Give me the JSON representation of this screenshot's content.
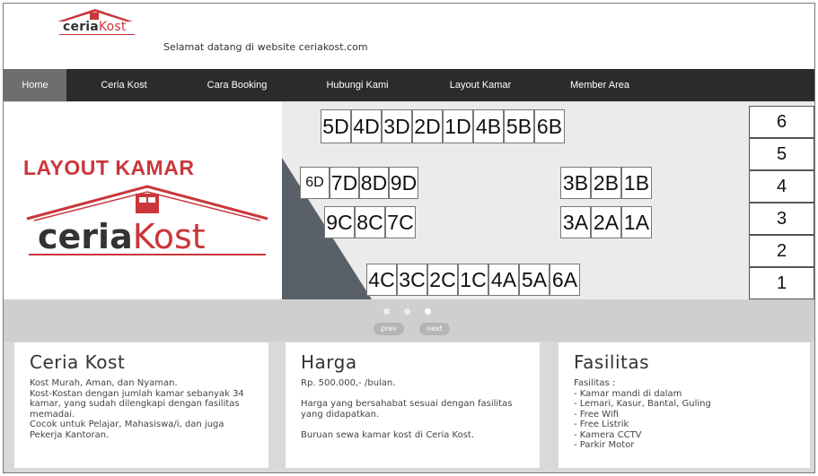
{
  "brand": {
    "name_a": "ceria",
    "name_b": "Kost"
  },
  "header": {
    "welcome": "Selamat datang di website ceriakost.com"
  },
  "nav": {
    "items": [
      {
        "label": "Home",
        "active": true
      },
      {
        "label": "Ceria Kost"
      },
      {
        "label": "Cara Booking"
      },
      {
        "label": "Hubungi Kami"
      },
      {
        "label": "Layout Kamar"
      },
      {
        "label": "Member Area"
      }
    ]
  },
  "slide": {
    "title": "LAYOUT KAMAR",
    "logo_a": "ceria",
    "logo_b": "Kost",
    "rooms_top": [
      "5D",
      "4D",
      "3D",
      "2D",
      "1D",
      "4B",
      "5B",
      "6B"
    ],
    "rooms_mid1_left": [
      "6D",
      "7D",
      "8D",
      "9D"
    ],
    "rooms_mid1_right": [
      "3B",
      "2B",
      "1B"
    ],
    "rooms_mid2_left": [
      "9C",
      "8C",
      "7C"
    ],
    "rooms_mid2_right": [
      "3A",
      "2A",
      "1A"
    ],
    "rooms_bottom": [
      "4C",
      "3C",
      "2C",
      "1C",
      "4A",
      "5A",
      "6A"
    ],
    "floors": [
      "6",
      "5",
      "4",
      "3",
      "2",
      "1"
    ]
  },
  "slider_controls": {
    "prev": "prev",
    "next": "next",
    "active_dot": 3,
    "dot_count": 3
  },
  "boxes": [
    {
      "title": "Ceria Kost",
      "body": "Kost Murah, Aman, dan Nyaman.\nKost-Kostan dengan jumlah kamar sebanyak 34 kamar, yang sudah dilengkapi dengan fasilitas memadai.\nCocok untuk Pelajar, Mahasiswa/i, dan juga Pekerja Kantoran."
    },
    {
      "title": "Harga",
      "body": "Rp. 500.000,- /bulan.\n\nHarga yang bersahabat sesuai dengan fasilitas yang didapatkan.\n\nBuruan sewa kamar kost di Ceria Kost."
    },
    {
      "title": "Fasilitas",
      "body": "Fasilitas :\n- Kamar mandi di dalam\n- Lemari, Kasur, Bantal, Guling\n- Free Wifi\n- Free Listrik\n- Kamera CCTV\n- Parkir Motor"
    }
  ],
  "colors": {
    "brand_red": "#c9373a",
    "nav_bg": "#2b2b2b",
    "nav_active": "#6e6e6e"
  }
}
